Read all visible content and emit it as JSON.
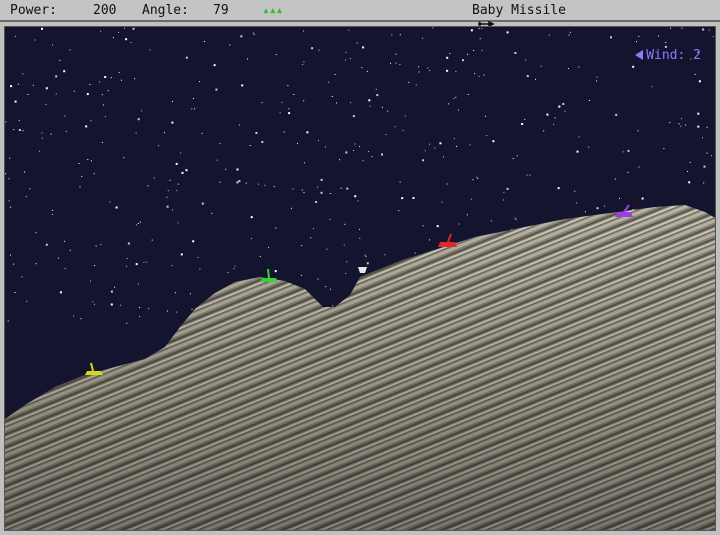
{
  "hud": {
    "power_label": "Power:",
    "power_value": "200",
    "angle_label": "Angle:",
    "angle_value": "79",
    "active_player_indicator": "▴▴▴",
    "active_player_color": "#2fbf2f",
    "weapon_icon": "missile-icon",
    "weapon_name": "Baby Missile"
  },
  "wind": {
    "label": "Wind:",
    "value": "2",
    "direction": "left",
    "color": "#8a7cff"
  },
  "tanks": [
    {
      "name": "yellow-tank",
      "color": "#d8d81a"
    },
    {
      "name": "green-tank",
      "color": "#3ccf3c"
    },
    {
      "name": "red-tank",
      "color": "#e02828"
    },
    {
      "name": "purple-tank",
      "color": "#9a3fe0"
    }
  ],
  "colors": {
    "sky": "#14142e",
    "terrain": "#8b8779"
  }
}
